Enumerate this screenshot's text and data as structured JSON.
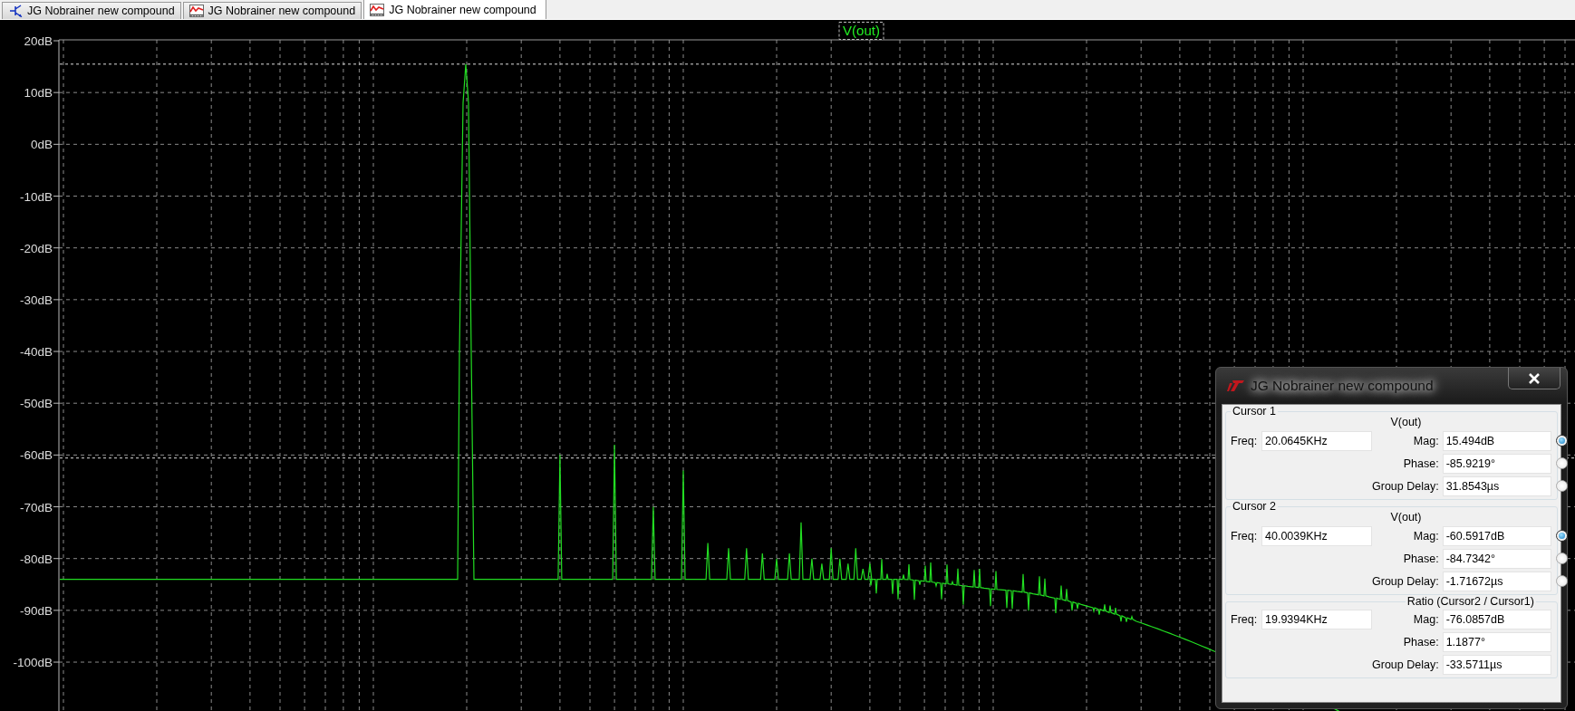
{
  "tabs": [
    {
      "label": "JG Nobrainer new compound",
      "kind": "schematic",
      "selected": false
    },
    {
      "label": "JG Nobrainer new compound",
      "kind": "waveform",
      "selected": false
    },
    {
      "label": "JG Nobrainer new compound",
      "kind": "waveform",
      "selected": true
    }
  ],
  "plot": {
    "trace_label": "V(out)",
    "y_axis_labels": [
      "20dB",
      "10dB",
      "0dB",
      "-10dB",
      "-20dB",
      "-30dB",
      "-40dB",
      "-50dB",
      "-60dB",
      "-70dB",
      "-80dB",
      "-90dB",
      "-100dB"
    ]
  },
  "cursor_dialog": {
    "title": "JG Nobrainer new compound",
    "sections": [
      {
        "kind": "cursor",
        "heading": "Cursor 1",
        "trace": "V(out)",
        "freq_label": "Freq:",
        "freq": "20.0645KHz",
        "rows": [
          {
            "label": "Mag:",
            "value": "15.494dB",
            "selected": true
          },
          {
            "label": "Phase:",
            "value": "-85.9219°",
            "selected": false
          },
          {
            "label": "Group Delay:",
            "value": "31.8543µs",
            "selected": false
          }
        ]
      },
      {
        "kind": "cursor",
        "heading": "Cursor 2",
        "trace": "V(out)",
        "freq_label": "Freq:",
        "freq": "40.0039KHz",
        "rows": [
          {
            "label": "Mag:",
            "value": "-60.5917dB",
            "selected": true
          },
          {
            "label": "Phase:",
            "value": "-84.7342°",
            "selected": false
          },
          {
            "label": "Group Delay:",
            "value": "-1.71672µs",
            "selected": false
          }
        ]
      },
      {
        "kind": "ratio",
        "heading": "Ratio (Cursor2 / Cursor1)",
        "freq_label": "Freq:",
        "freq": "19.9394KHz",
        "rows": [
          {
            "label": "Mag:",
            "value": "-76.0857dB"
          },
          {
            "label": "Phase:",
            "value": "1.1877°"
          },
          {
            "label": "Group Delay:",
            "value": "-33.5711µs"
          }
        ]
      }
    ]
  }
}
